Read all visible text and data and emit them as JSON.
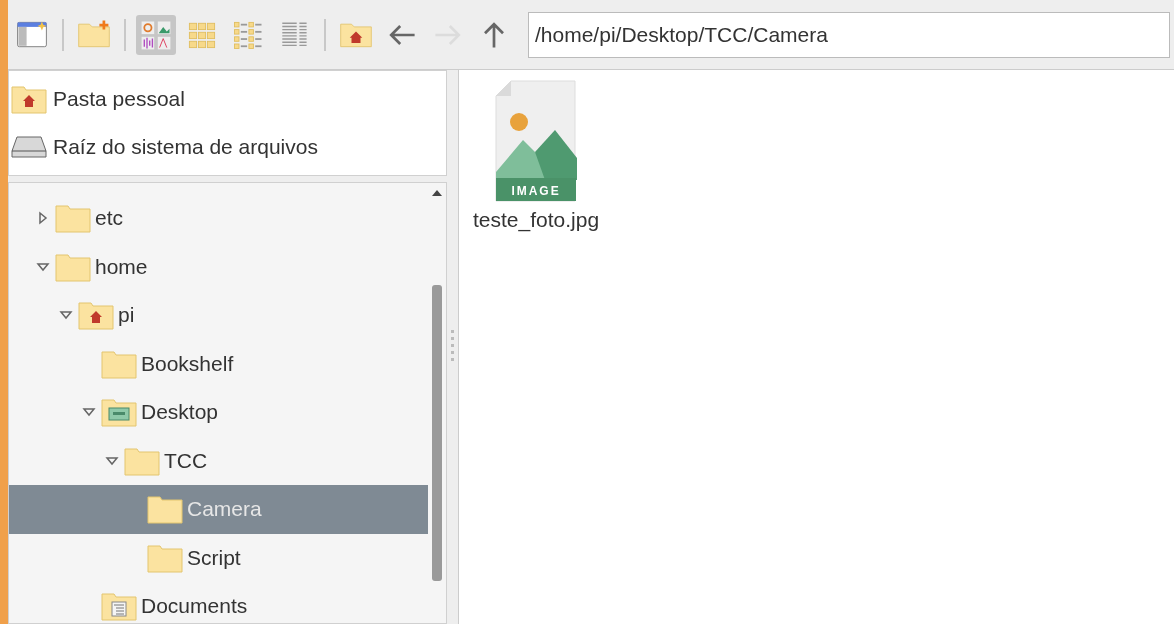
{
  "toolbar": {
    "buttons": [
      {
        "kind": "new-window",
        "selected": false,
        "disabled": false
      },
      {
        "kind": "separator"
      },
      {
        "kind": "new-folder",
        "selected": false,
        "disabled": false
      },
      {
        "kind": "separator"
      },
      {
        "kind": "view-icons",
        "selected": true,
        "disabled": false
      },
      {
        "kind": "view-thumbnails",
        "selected": false,
        "disabled": false
      },
      {
        "kind": "view-compact",
        "selected": false,
        "disabled": false
      },
      {
        "kind": "view-list",
        "selected": false,
        "disabled": false
      },
      {
        "kind": "separator"
      },
      {
        "kind": "home",
        "selected": false,
        "disabled": false
      },
      {
        "kind": "back",
        "selected": false,
        "disabled": false
      },
      {
        "kind": "forward",
        "selected": false,
        "disabled": true
      },
      {
        "kind": "up",
        "selected": false,
        "disabled": false
      }
    ],
    "path": "/home/pi/Desktop/TCC/Camera"
  },
  "places": [
    {
      "label": "Pasta pessoal",
      "kind": "home"
    },
    {
      "label": "Raíz do sistema de arquivos",
      "kind": "drive"
    }
  ],
  "tree": [
    {
      "label": "etc",
      "kind": "folder",
      "expanded": false,
      "selected": false
    },
    {
      "label": "home",
      "kind": "folder",
      "expanded": true,
      "selected": false,
      "children": [
        {
          "label": "pi",
          "kind": "home",
          "expanded": true,
          "selected": false,
          "children": [
            {
              "label": "Bookshelf",
              "kind": "folder",
              "selected": false
            },
            {
              "label": "Desktop",
              "kind": "desktop",
              "expanded": true,
              "selected": false,
              "children": [
                {
                  "label": "TCC",
                  "kind": "folder",
                  "expanded": true,
                  "selected": false,
                  "children": [
                    {
                      "label": "Camera",
                      "kind": "folder",
                      "selected": true
                    },
                    {
                      "label": "Script",
                      "kind": "folder",
                      "selected": false
                    }
                  ]
                }
              ]
            },
            {
              "label": "Documents",
              "kind": "documents",
              "selected": false
            }
          ]
        }
      ]
    }
  ],
  "files": [
    {
      "name": "teste_foto.jpg",
      "kind": "image",
      "icon_label": "IMAGE"
    }
  ]
}
